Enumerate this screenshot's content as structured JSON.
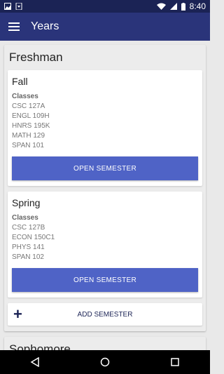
{
  "status_bar": {
    "time": "8:40"
  },
  "app_bar": {
    "title": "Years"
  },
  "years": [
    {
      "title": "Freshman",
      "semesters": [
        {
          "title": "Fall",
          "classes_label": "Classes",
          "classes": [
            "CSC 127A",
            "ENGL 109H",
            "HNRS 195K",
            "MATH 129",
            "SPAN 101"
          ],
          "button": "OPEN SEMESTER"
        },
        {
          "title": "Spring",
          "classes_label": "Classes",
          "classes": [
            "CSC 127B",
            "ECON 150C1",
            "PHYS 141",
            "SPAN 102"
          ],
          "button": "OPEN SEMESTER"
        }
      ],
      "add_label": "ADD SEMESTER"
    },
    {
      "title": "Sophomore"
    }
  ],
  "colors": {
    "status_bar": "#1b2355",
    "app_bar": "#2a347a",
    "button": "#4f63c6"
  }
}
